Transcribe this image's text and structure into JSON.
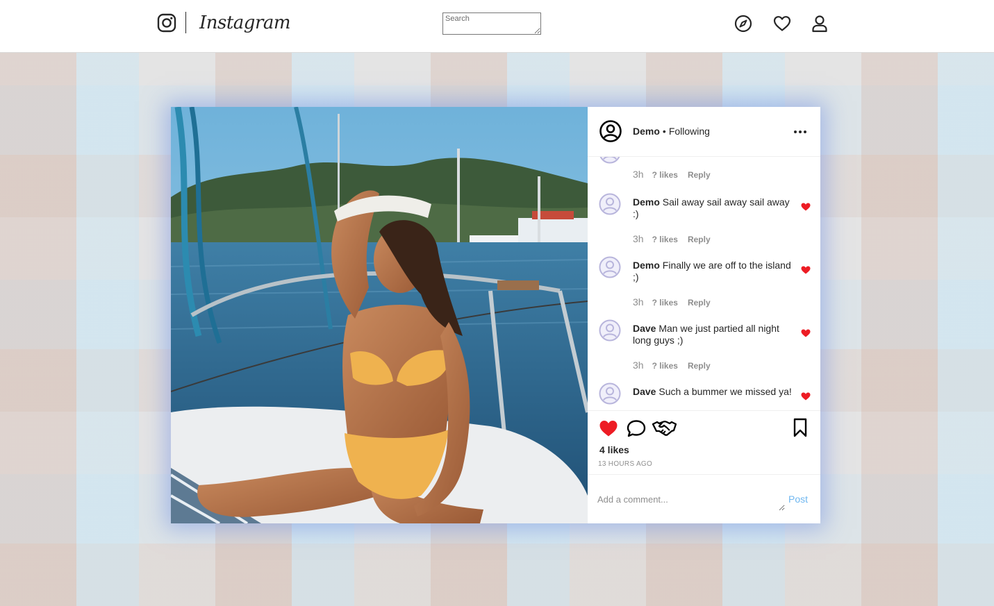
{
  "header": {
    "brand": "Instagram",
    "search": {
      "placeholder": "Search",
      "value": ""
    },
    "nav_icons": [
      "compass-icon",
      "heart-icon",
      "user-icon"
    ]
  },
  "post": {
    "owner": {
      "username": "Demo",
      "separator": "•",
      "follow_status": "Following"
    },
    "comments": [
      {
        "user": "",
        "text": "",
        "time": "3h",
        "likes": "? likes",
        "reply": "Reply",
        "liked": true
      },
      {
        "user": "Demo",
        "text": "Sail away sail away sail away :)",
        "time": "3h",
        "likes": "? likes",
        "reply": "Reply",
        "liked": true
      },
      {
        "user": "Demo",
        "text": "Finally we are off to the island ;)",
        "time": "3h",
        "likes": "? likes",
        "reply": "Reply",
        "liked": true
      },
      {
        "user": "Dave",
        "text": "Man we just partied all night long guys ;)",
        "time": "3h",
        "likes": "? likes",
        "reply": "Reply",
        "liked": true
      },
      {
        "user": "Dave",
        "text": "Such a bummer we missed ya!",
        "time": "",
        "likes": "",
        "reply": "",
        "liked": true
      }
    ],
    "likes_count": "4 likes",
    "timestamp": "13 HOURS AGO",
    "add_comment": {
      "placeholder": "Add a comment...",
      "post_label": "Post"
    },
    "liked": true
  },
  "colors": {
    "like_red": "#ed1c24",
    "post_blue": "#6fb7f0",
    "muted_text": "#8e8e8e",
    "avatar_purple": "#b8b5dc",
    "card_glow": "#7896e1"
  }
}
